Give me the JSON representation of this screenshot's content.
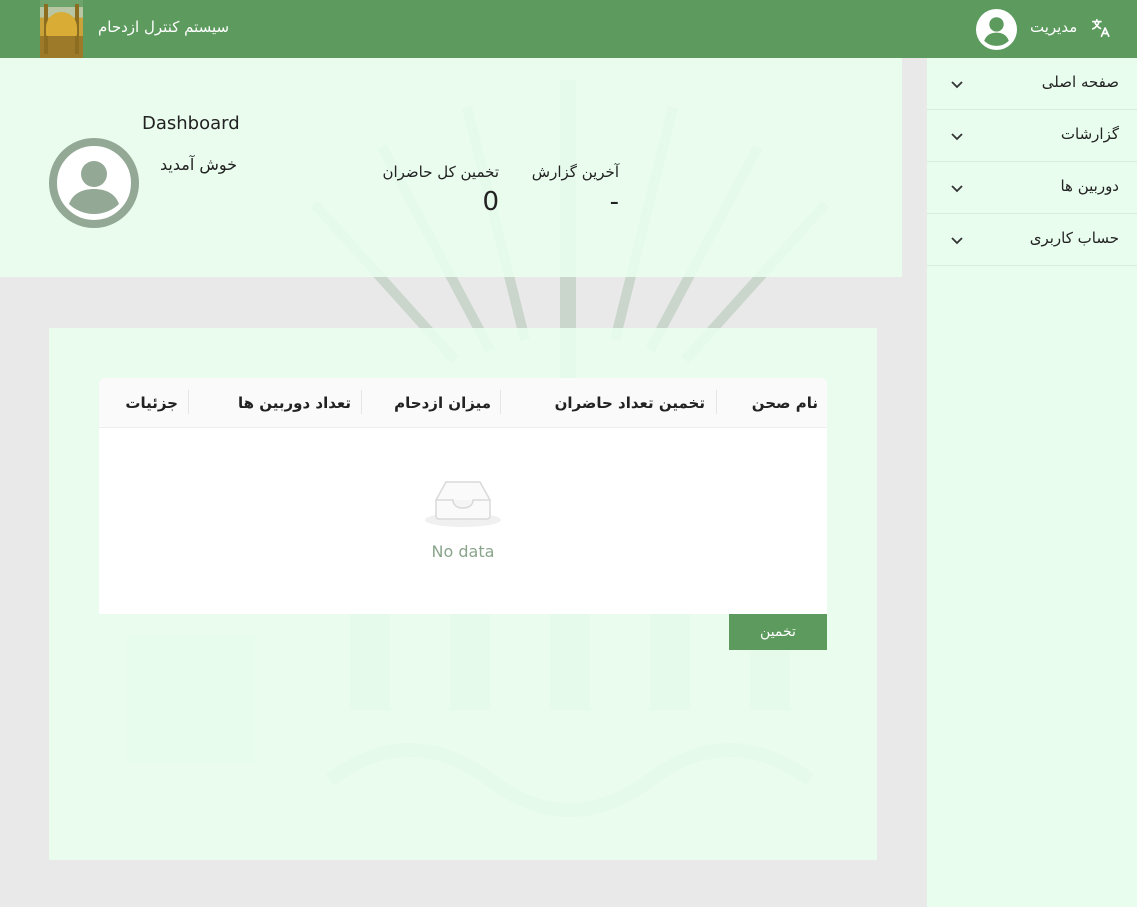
{
  "header": {
    "app_title": "سیستم کنترل ازدحام",
    "user_label": "مدیریت",
    "icons": [
      "logo",
      "translate-icon",
      "user-avatar-icon"
    ]
  },
  "sidebar": {
    "items": [
      {
        "label": "صفحه اصلی"
      },
      {
        "label": "گزارشات"
      },
      {
        "label": "دوربین ها"
      },
      {
        "label": "حساب کاربری"
      }
    ]
  },
  "dashboard": {
    "title": "Dashboard",
    "welcome": "خوش آمدید",
    "stats": {
      "last_report_label": "آخرین گزارش",
      "last_report_value": "-",
      "total_estimate_label": "تخمین کل حاضران",
      "total_estimate_value": "0"
    }
  },
  "table": {
    "columns": [
      "نام صحن",
      "تخمین تعداد حاضران",
      "میزان ازدحام",
      "تعداد دوربین ها",
      "جزئیات"
    ],
    "rows": [],
    "empty_text": "No data"
  },
  "actions": {
    "estimate_label": "تخمین"
  },
  "colors": {
    "primary": "#5c9a5e",
    "panel": "#e8fdee",
    "background": "#e9e9e9"
  }
}
